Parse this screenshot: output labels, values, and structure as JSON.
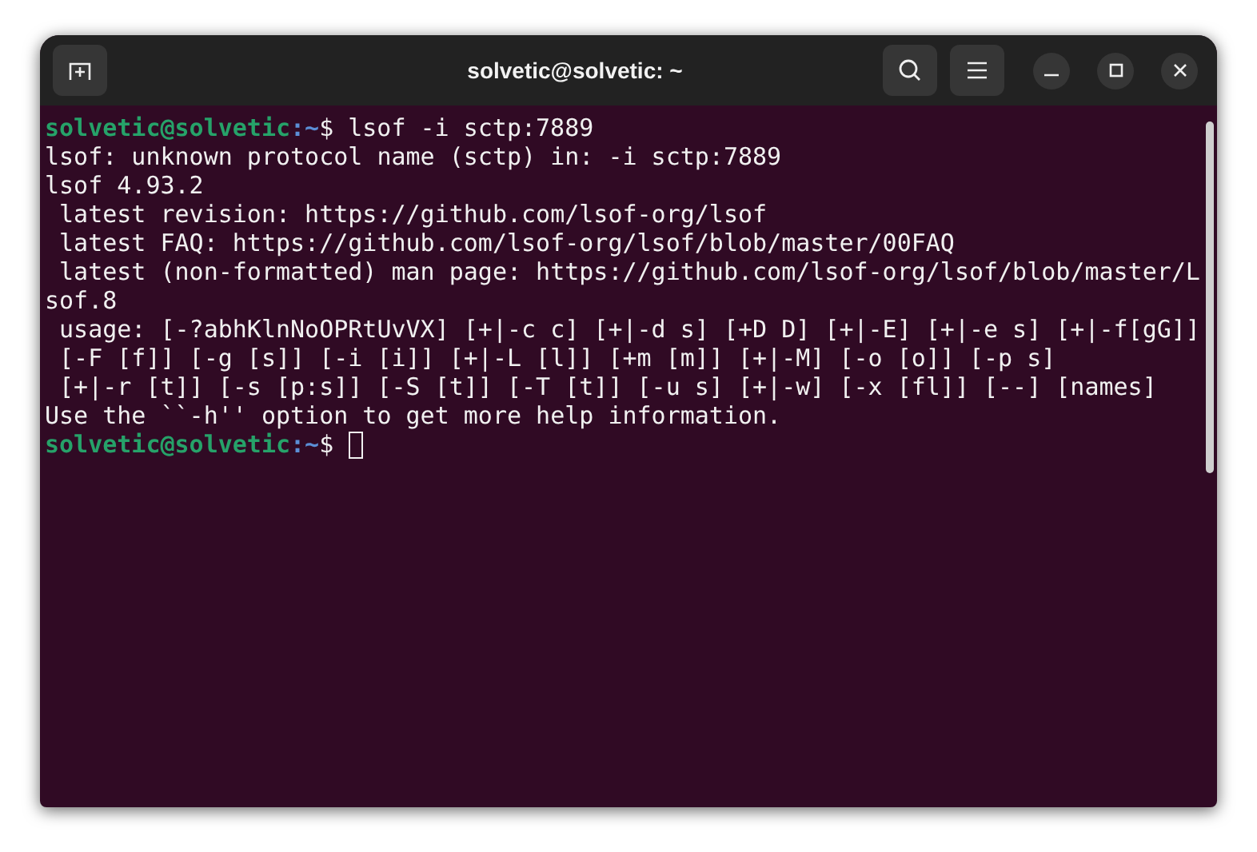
{
  "window": {
    "title": "solvetic@solvetic: ~"
  },
  "terminal": {
    "lines": [
      {
        "kind": "prompt",
        "user": "solvetic@solvetic",
        "path": ":~",
        "symbol": "$",
        "command": "lsof -i sctp:7889",
        "cursor": false
      },
      {
        "kind": "output",
        "text": "lsof: unknown protocol name (sctp) in: -i sctp:7889"
      },
      {
        "kind": "output",
        "text": "lsof 4.93.2"
      },
      {
        "kind": "output",
        "text": " latest revision: https://github.com/lsof-org/lsof"
      },
      {
        "kind": "output",
        "text": " latest FAQ: https://github.com/lsof-org/lsof/blob/master/00FAQ"
      },
      {
        "kind": "output",
        "text": " latest (non-formatted) man page: https://github.com/lsof-org/lsof/blob/master/L"
      },
      {
        "kind": "output",
        "text": "sof.8"
      },
      {
        "kind": "output",
        "text": " usage: [-?abhKlnNoOPRtUvVX] [+|-c c] [+|-d s] [+D D] [+|-E] [+|-e s] [+|-f[gG]]"
      },
      {
        "kind": "output",
        "text": " [-F [f]] [-g [s]] [-i [i]] [+|-L [l]] [+m [m]] [+|-M] [-o [o]] [-p s]"
      },
      {
        "kind": "output",
        "text": " [+|-r [t]] [-s [p:s]] [-S [t]] [-T [t]] [-u s] [+|-w] [-x [fl]] [--] [names]"
      },
      {
        "kind": "output",
        "text": "Use the ``-h'' option to get more help information."
      },
      {
        "kind": "prompt",
        "user": "solvetic@solvetic",
        "path": ":~",
        "symbol": "$",
        "cursor": true
      }
    ]
  }
}
